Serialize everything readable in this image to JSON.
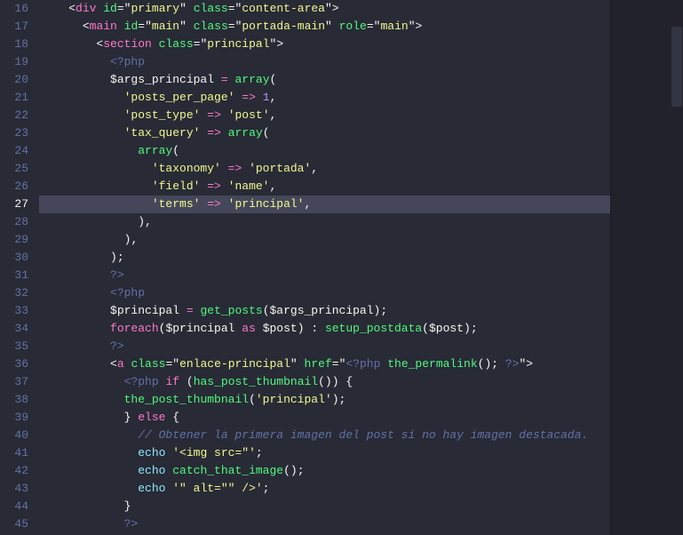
{
  "colors": {
    "bg": "#282a36",
    "gutter": "#6272a4",
    "highlight": "#44475a",
    "fg": "#f8f8f2",
    "keyword": "#ff79c6",
    "func": "#50fa7b",
    "string": "#f1fa8c",
    "number": "#bd93f9",
    "comment": "#6272a4",
    "builtin": "#8be9fd"
  },
  "first_line_number": 16,
  "current_line_number": 27,
  "lines": [
    {
      "n": 16,
      "indent": 2,
      "tokens": [
        {
          "c": "c-punc",
          "t": "<"
        },
        {
          "c": "c-tag",
          "t": "div"
        },
        {
          "c": "",
          "t": " "
        },
        {
          "c": "c-attr",
          "t": "id"
        },
        {
          "c": "c-punc",
          "t": "="
        },
        {
          "c": "c-punc",
          "t": "\""
        },
        {
          "c": "c-str",
          "t": "primary"
        },
        {
          "c": "c-punc",
          "t": "\""
        },
        {
          "c": "",
          "t": " "
        },
        {
          "c": "c-attr",
          "t": "class"
        },
        {
          "c": "c-punc",
          "t": "="
        },
        {
          "c": "c-punc",
          "t": "\""
        },
        {
          "c": "c-str",
          "t": "content-area"
        },
        {
          "c": "c-punc",
          "t": "\""
        },
        {
          "c": "c-punc",
          "t": ">"
        }
      ]
    },
    {
      "n": 17,
      "indent": 3,
      "tokens": [
        {
          "c": "c-punc",
          "t": "<"
        },
        {
          "c": "c-tag",
          "t": "main"
        },
        {
          "c": "",
          "t": " "
        },
        {
          "c": "c-attr",
          "t": "id"
        },
        {
          "c": "c-punc",
          "t": "="
        },
        {
          "c": "c-punc",
          "t": "\""
        },
        {
          "c": "c-str",
          "t": "main"
        },
        {
          "c": "c-punc",
          "t": "\""
        },
        {
          "c": "",
          "t": " "
        },
        {
          "c": "c-attr",
          "t": "class"
        },
        {
          "c": "c-punc",
          "t": "="
        },
        {
          "c": "c-punc",
          "t": "\""
        },
        {
          "c": "c-str",
          "t": "portada-main"
        },
        {
          "c": "c-punc",
          "t": "\""
        },
        {
          "c": "",
          "t": " "
        },
        {
          "c": "c-attr",
          "t": "role"
        },
        {
          "c": "c-punc",
          "t": "="
        },
        {
          "c": "c-punc",
          "t": "\""
        },
        {
          "c": "c-str",
          "t": "main"
        },
        {
          "c": "c-punc",
          "t": "\""
        },
        {
          "c": "c-punc",
          "t": ">"
        }
      ]
    },
    {
      "n": 18,
      "indent": 4,
      "tokens": [
        {
          "c": "c-punc",
          "t": "<"
        },
        {
          "c": "c-tag",
          "t": "section"
        },
        {
          "c": "",
          "t": " "
        },
        {
          "c": "c-attr",
          "t": "class"
        },
        {
          "c": "c-punc",
          "t": "="
        },
        {
          "c": "c-punc",
          "t": "\""
        },
        {
          "c": "c-str",
          "t": "principal"
        },
        {
          "c": "c-punc",
          "t": "\""
        },
        {
          "c": "c-punc",
          "t": ">"
        }
      ]
    },
    {
      "n": 19,
      "indent": 5,
      "tokens": [
        {
          "c": "c-phpdel",
          "t": "<?php"
        }
      ]
    },
    {
      "n": 20,
      "indent": 5,
      "tokens": [
        {
          "c": "c-var",
          "t": "$args_principal"
        },
        {
          "c": "",
          "t": " "
        },
        {
          "c": "c-key",
          "t": "="
        },
        {
          "c": "",
          "t": " "
        },
        {
          "c": "c-func",
          "t": "array"
        },
        {
          "c": "c-punc",
          "t": "("
        }
      ]
    },
    {
      "n": 21,
      "indent": 6,
      "tokens": [
        {
          "c": "c-str",
          "t": "'posts_per_page'"
        },
        {
          "c": "",
          "t": " "
        },
        {
          "c": "c-key",
          "t": "=>"
        },
        {
          "c": "",
          "t": " "
        },
        {
          "c": "c-num",
          "t": "1"
        },
        {
          "c": "c-punc",
          "t": ","
        }
      ]
    },
    {
      "n": 22,
      "indent": 6,
      "tokens": [
        {
          "c": "c-str",
          "t": "'post_type'"
        },
        {
          "c": "",
          "t": " "
        },
        {
          "c": "c-key",
          "t": "=>"
        },
        {
          "c": "",
          "t": " "
        },
        {
          "c": "c-str",
          "t": "'post'"
        },
        {
          "c": "c-punc",
          "t": ","
        }
      ]
    },
    {
      "n": 23,
      "indent": 6,
      "tokens": [
        {
          "c": "c-str",
          "t": "'tax_query'"
        },
        {
          "c": "",
          "t": " "
        },
        {
          "c": "c-key",
          "t": "=>"
        },
        {
          "c": "",
          "t": " "
        },
        {
          "c": "c-func",
          "t": "array"
        },
        {
          "c": "c-punc",
          "t": "("
        }
      ]
    },
    {
      "n": 24,
      "indent": 7,
      "tokens": [
        {
          "c": "c-func",
          "t": "array"
        },
        {
          "c": "c-punc",
          "t": "("
        }
      ]
    },
    {
      "n": 25,
      "indent": 8,
      "tokens": [
        {
          "c": "c-str",
          "t": "'taxonomy'"
        },
        {
          "c": "",
          "t": " "
        },
        {
          "c": "c-key",
          "t": "=>"
        },
        {
          "c": "",
          "t": " "
        },
        {
          "c": "c-str",
          "t": "'portada'"
        },
        {
          "c": "c-punc",
          "t": ","
        }
      ]
    },
    {
      "n": 26,
      "indent": 8,
      "tokens": [
        {
          "c": "c-str",
          "t": "'field'"
        },
        {
          "c": "",
          "t": " "
        },
        {
          "c": "c-key",
          "t": "=>"
        },
        {
          "c": "",
          "t": " "
        },
        {
          "c": "c-str",
          "t": "'name'"
        },
        {
          "c": "c-punc",
          "t": ","
        }
      ]
    },
    {
      "n": 27,
      "indent": 8,
      "hl": true,
      "tokens": [
        {
          "c": "c-str",
          "t": "'terms'"
        },
        {
          "c": "",
          "t": " "
        },
        {
          "c": "c-key",
          "t": "=>"
        },
        {
          "c": "",
          "t": " "
        },
        {
          "c": "c-str",
          "t": "'principal'"
        },
        {
          "c": "c-punc",
          "t": ","
        }
      ]
    },
    {
      "n": 28,
      "indent": 7,
      "tokens": [
        {
          "c": "c-punc",
          "t": ")"
        },
        {
          "c": "c-punc",
          "t": ","
        }
      ]
    },
    {
      "n": 29,
      "indent": 6,
      "tokens": [
        {
          "c": "c-punc",
          "t": ")"
        },
        {
          "c": "c-punc",
          "t": ","
        }
      ]
    },
    {
      "n": 30,
      "indent": 5,
      "tokens": [
        {
          "c": "c-punc",
          "t": ")"
        },
        {
          "c": "c-punc",
          "t": ";"
        }
      ]
    },
    {
      "n": 31,
      "indent": 5,
      "tokens": [
        {
          "c": "c-phpdel",
          "t": "?>"
        }
      ]
    },
    {
      "n": 32,
      "indent": 5,
      "tokens": [
        {
          "c": "c-phpdel",
          "t": "<?php"
        }
      ]
    },
    {
      "n": 33,
      "indent": 5,
      "tokens": [
        {
          "c": "c-var",
          "t": "$principal"
        },
        {
          "c": "",
          "t": " "
        },
        {
          "c": "c-key",
          "t": "="
        },
        {
          "c": "",
          "t": " "
        },
        {
          "c": "c-func",
          "t": "get_posts"
        },
        {
          "c": "c-punc",
          "t": "("
        },
        {
          "c": "c-var",
          "t": "$args_principal"
        },
        {
          "c": "c-punc",
          "t": ")"
        },
        {
          "c": "c-punc",
          "t": ";"
        }
      ]
    },
    {
      "n": 34,
      "indent": 5,
      "tokens": [
        {
          "c": "c-key",
          "t": "foreach"
        },
        {
          "c": "c-punc",
          "t": "("
        },
        {
          "c": "c-var",
          "t": "$principal"
        },
        {
          "c": "",
          "t": " "
        },
        {
          "c": "c-key",
          "t": "as"
        },
        {
          "c": "",
          "t": " "
        },
        {
          "c": "c-var",
          "t": "$post"
        },
        {
          "c": "c-punc",
          "t": ")"
        },
        {
          "c": "",
          "t": " "
        },
        {
          "c": "c-punc",
          "t": ":"
        },
        {
          "c": "",
          "t": " "
        },
        {
          "c": "c-func",
          "t": "setup_postdata"
        },
        {
          "c": "c-punc",
          "t": "("
        },
        {
          "c": "c-var",
          "t": "$post"
        },
        {
          "c": "c-punc",
          "t": ")"
        },
        {
          "c": "c-punc",
          "t": ";"
        }
      ]
    },
    {
      "n": 35,
      "indent": 5,
      "tokens": [
        {
          "c": "c-phpdel",
          "t": "?>"
        }
      ]
    },
    {
      "n": 36,
      "indent": 5,
      "tokens": [
        {
          "c": "c-punc",
          "t": "<"
        },
        {
          "c": "c-tag",
          "t": "a"
        },
        {
          "c": "",
          "t": " "
        },
        {
          "c": "c-attr",
          "t": "class"
        },
        {
          "c": "c-punc",
          "t": "="
        },
        {
          "c": "c-punc",
          "t": "\""
        },
        {
          "c": "c-str",
          "t": "enlace-principal"
        },
        {
          "c": "c-punc",
          "t": "\""
        },
        {
          "c": "",
          "t": " "
        },
        {
          "c": "c-attr",
          "t": "href"
        },
        {
          "c": "c-punc",
          "t": "="
        },
        {
          "c": "c-punc",
          "t": "\""
        },
        {
          "c": "c-phpdel",
          "t": "<?php"
        },
        {
          "c": "",
          "t": " "
        },
        {
          "c": "c-func",
          "t": "the_permalink"
        },
        {
          "c": "c-punc",
          "t": "()"
        },
        {
          "c": "c-punc",
          "t": ";"
        },
        {
          "c": "",
          "t": " "
        },
        {
          "c": "c-phpdel",
          "t": "?>"
        },
        {
          "c": "c-punc",
          "t": "\""
        },
        {
          "c": "c-punc",
          "t": ">"
        }
      ]
    },
    {
      "n": 37,
      "indent": 6,
      "tokens": [
        {
          "c": "c-phpdel",
          "t": "<?php"
        },
        {
          "c": "",
          "t": " "
        },
        {
          "c": "c-key",
          "t": "if"
        },
        {
          "c": "",
          "t": " "
        },
        {
          "c": "c-punc",
          "t": "("
        },
        {
          "c": "c-func",
          "t": "has_post_thumbnail"
        },
        {
          "c": "c-punc",
          "t": "()"
        },
        {
          "c": "c-punc",
          "t": ")"
        },
        {
          "c": "",
          "t": " "
        },
        {
          "c": "c-punc",
          "t": "{"
        }
      ]
    },
    {
      "n": 38,
      "indent": 6,
      "tokens": [
        {
          "c": "c-func",
          "t": "the_post_thumbnail"
        },
        {
          "c": "c-punc",
          "t": "("
        },
        {
          "c": "c-str",
          "t": "'principal'"
        },
        {
          "c": "c-punc",
          "t": ")"
        },
        {
          "c": "c-punc",
          "t": ";"
        }
      ]
    },
    {
      "n": 39,
      "indent": 6,
      "tokens": [
        {
          "c": "c-punc",
          "t": "}"
        },
        {
          "c": "",
          "t": " "
        },
        {
          "c": "c-key",
          "t": "else"
        },
        {
          "c": "",
          "t": " "
        },
        {
          "c": "c-punc",
          "t": "{"
        }
      ]
    },
    {
      "n": 40,
      "indent": 7,
      "tokens": [
        {
          "c": "c-comm",
          "t": "// Obtener la primera imagen del post si no hay imagen destacada."
        }
      ]
    },
    {
      "n": 41,
      "indent": 7,
      "tokens": [
        {
          "c": "c-builtin",
          "t": "echo"
        },
        {
          "c": "",
          "t": " "
        },
        {
          "c": "c-str",
          "t": "'<img src=\"'"
        },
        {
          "c": "c-punc",
          "t": ";"
        }
      ]
    },
    {
      "n": 42,
      "indent": 7,
      "tokens": [
        {
          "c": "c-builtin",
          "t": "echo"
        },
        {
          "c": "",
          "t": " "
        },
        {
          "c": "c-func",
          "t": "catch_that_image"
        },
        {
          "c": "c-punc",
          "t": "()"
        },
        {
          "c": "c-punc",
          "t": ";"
        }
      ]
    },
    {
      "n": 43,
      "indent": 7,
      "tokens": [
        {
          "c": "c-builtin",
          "t": "echo"
        },
        {
          "c": "",
          "t": " "
        },
        {
          "c": "c-str",
          "t": "'\" alt=\"\" />'"
        },
        {
          "c": "c-punc",
          "t": ";"
        }
      ]
    },
    {
      "n": 44,
      "indent": 6,
      "tokens": [
        {
          "c": "c-punc",
          "t": "}"
        }
      ]
    },
    {
      "n": 45,
      "indent": 6,
      "tokens": [
        {
          "c": "c-phpdel",
          "t": "?>"
        }
      ]
    }
  ]
}
